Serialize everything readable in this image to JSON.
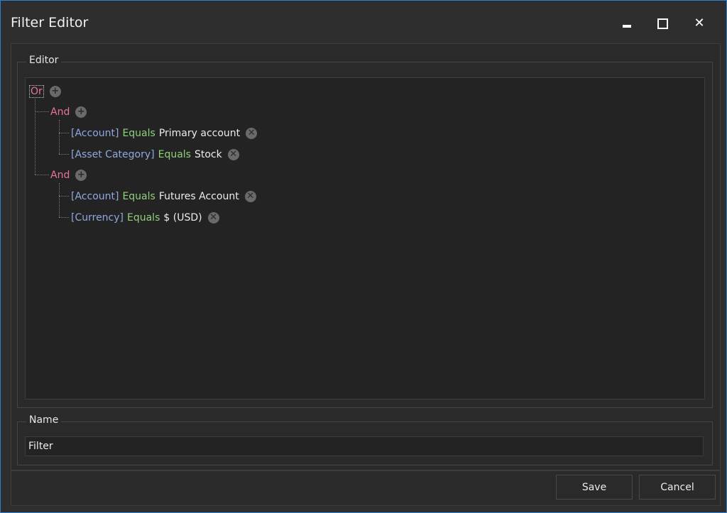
{
  "window": {
    "title": "Filter Editor",
    "controls": {
      "minimize": "minimize-icon",
      "maximize": "maximize-icon",
      "close": "close-icon"
    }
  },
  "editor": {
    "group_label": "Editor",
    "root": {
      "operator": "Or"
    },
    "groups": [
      {
        "operator": "And",
        "conditions": [
          {
            "field": "[Account]",
            "op": "Equals",
            "value": "Primary account"
          },
          {
            "field": "[Asset Category]",
            "op": "Equals",
            "value": "Stock"
          }
        ]
      },
      {
        "operator": "And",
        "conditions": [
          {
            "field": "[Account]",
            "op": "Equals",
            "value": "Futures Account"
          },
          {
            "field": "[Currency]",
            "op": "Equals",
            "value": "$ (USD)"
          }
        ]
      }
    ],
    "colors": {
      "group": "#e6739f",
      "field": "#8fa8e0",
      "operator": "#8fd07a",
      "value": "#ececec"
    }
  },
  "name": {
    "group_label": "Name",
    "value": "Filter"
  },
  "footer": {
    "save_label": "Save",
    "cancel_label": "Cancel"
  }
}
